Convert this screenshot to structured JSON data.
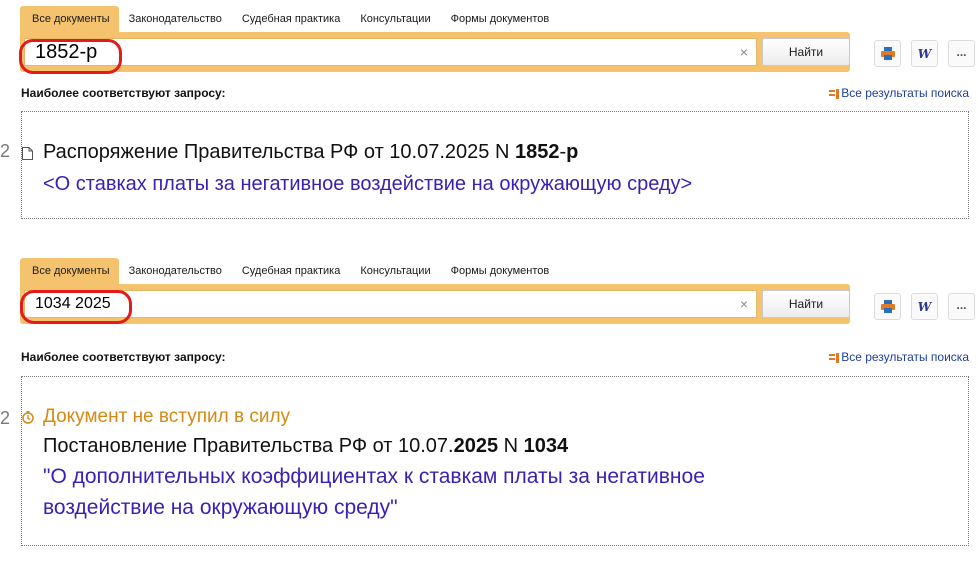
{
  "tabs": [
    "Все документы",
    "Законодательство",
    "Судебная практика",
    "Консультации",
    "Формы документов"
  ],
  "search_panels": [
    {
      "query": "1852-р",
      "find_label": "Найти",
      "clear_symbol": "×",
      "best_match_label": "Наиболее соответствуют запросу:",
      "all_results_label": "Все результаты поиска",
      "result": {
        "number": "2",
        "title_prefix": "Распоряжение Правительства РФ от 10.07.2025 N ",
        "title_bold_1": "1852",
        "title_dash": "-",
        "title_bold_2": "р",
        "subtitle": "<О ставках платы за негативное воздействие на окружающую среду>"
      }
    },
    {
      "query": "1034 2025",
      "find_label": "Найти",
      "clear_symbol": "×",
      "best_match_label": "Наиболее соответствуют запросу:",
      "all_results_label": "Все результаты поиска",
      "result": {
        "number": "2",
        "status": "Документ не вступил в силу",
        "title_prefix": "Постановление Правительства РФ от 10.07.",
        "title_bold_year": "2025",
        "title_mid": " N ",
        "title_bold_num": "1034",
        "subtitle_line1": "\"О дополнительных коэффициентах к ставкам платы за негативное",
        "subtitle_line2": "воздействие на окружающую среду\""
      }
    }
  ],
  "toolbar": {
    "print_icon": "printer-icon",
    "word_label": "W",
    "more_label": "..."
  },
  "colors": {
    "accent": "#f5c36e",
    "highlight": "#e31b1b",
    "link_blue": "#3a1fb4",
    "status_orange": "#d48a12"
  }
}
